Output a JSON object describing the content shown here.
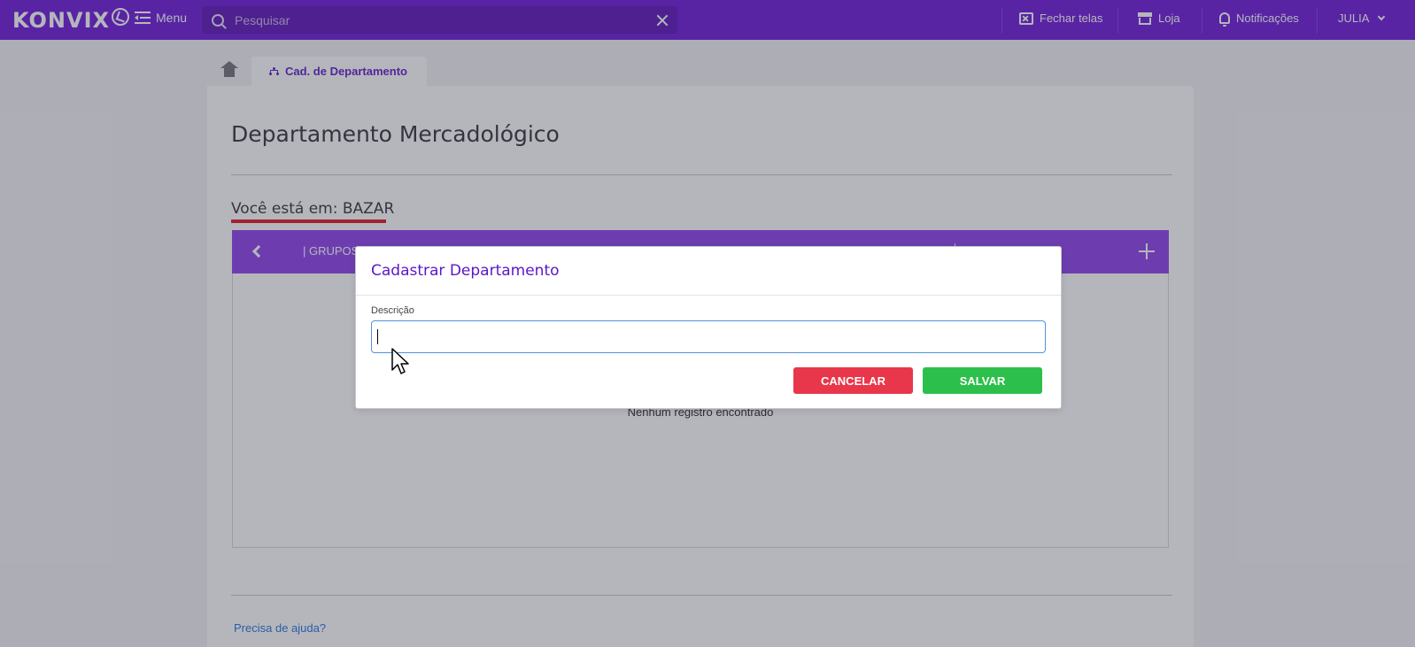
{
  "topbar": {
    "logo_text": "KONVIX",
    "menu_label": "Menu",
    "search_placeholder": "Pesquisar",
    "actions": {
      "close_screens": "Fechar telas",
      "store": "Loja",
      "notifications": "Notificações"
    },
    "user_name": "JULIA"
  },
  "tabs": {
    "active_label": "Cad. de Departamento"
  },
  "page": {
    "title": "Departamento Mercadológico",
    "breadcrumb": "Você está em: BAZAR",
    "grid": {
      "header_label": "| GRUPOS",
      "empty_message": "Nenhum registro encontrado"
    },
    "help_link": "Precisa de ajuda?"
  },
  "modal": {
    "title": "Cadastrar Departamento",
    "field_label": "Descrição",
    "field_value": "",
    "cancel_label": "CANCELAR",
    "save_label": "SALVAR"
  },
  "colors": {
    "brand": "#6a14d8",
    "grid_header": "#8b3dec",
    "cancel": "#e8374a",
    "save": "#2dbf4b",
    "breadcrumb_underline": "#e0101d",
    "link": "#1a73d9"
  }
}
